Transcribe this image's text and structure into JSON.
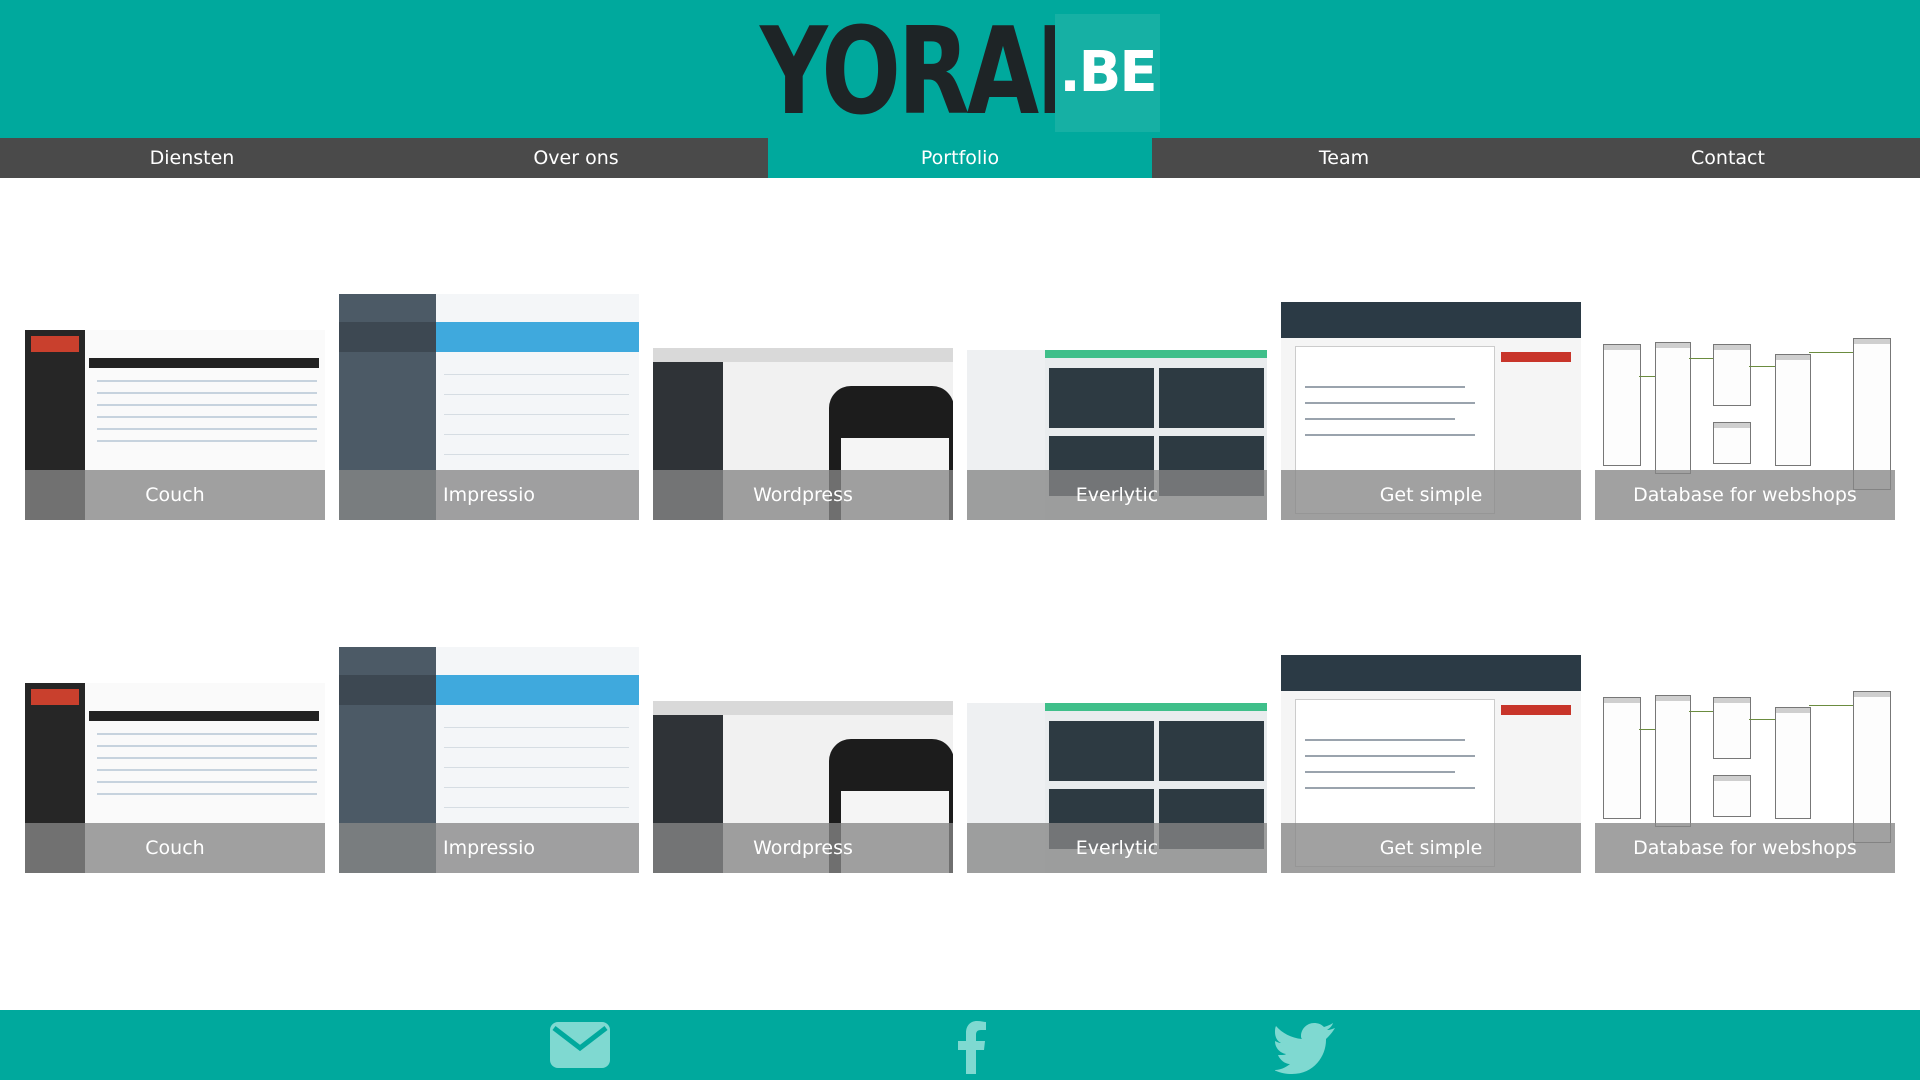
{
  "header": {
    "logo_text": "YORAM",
    "logo_tld": ".BE",
    "accent_color": "#00a99d"
  },
  "nav": {
    "items": [
      {
        "label": "Diensten"
      },
      {
        "label": "Over ons"
      },
      {
        "label": "Portfolio"
      },
      {
        "label": "Team"
      },
      {
        "label": "Contact"
      }
    ],
    "active": "Portfolio"
  },
  "portfolio": {
    "rows": [
      {
        "items": [
          {
            "label": "Couch",
            "icon": "couch-cms-screenshot"
          },
          {
            "label": "Impressio",
            "icon": "impressio-screenshot"
          },
          {
            "label": "Wordpress",
            "icon": "wordpress-screenshot"
          },
          {
            "label": "Everlytic",
            "icon": "everlytic-screenshot"
          },
          {
            "label": "Get simple",
            "icon": "getsimple-screenshot"
          },
          {
            "label": "Database for webshops",
            "icon": "database-diagram-screenshot"
          }
        ]
      },
      {
        "items": [
          {
            "label": "Couch",
            "icon": "couch-cms-screenshot"
          },
          {
            "label": "Impressio",
            "icon": "impressio-screenshot"
          },
          {
            "label": "Wordpress",
            "icon": "wordpress-screenshot"
          },
          {
            "label": "Everlytic",
            "icon": "everlytic-screenshot"
          },
          {
            "label": "Get simple",
            "icon": "getsimple-screenshot"
          },
          {
            "label": "Database for webshops",
            "icon": "database-diagram-screenshot"
          }
        ]
      }
    ]
  },
  "footer": {
    "icons": [
      "envelope-icon",
      "facebook-icon",
      "twitter-icon"
    ]
  }
}
